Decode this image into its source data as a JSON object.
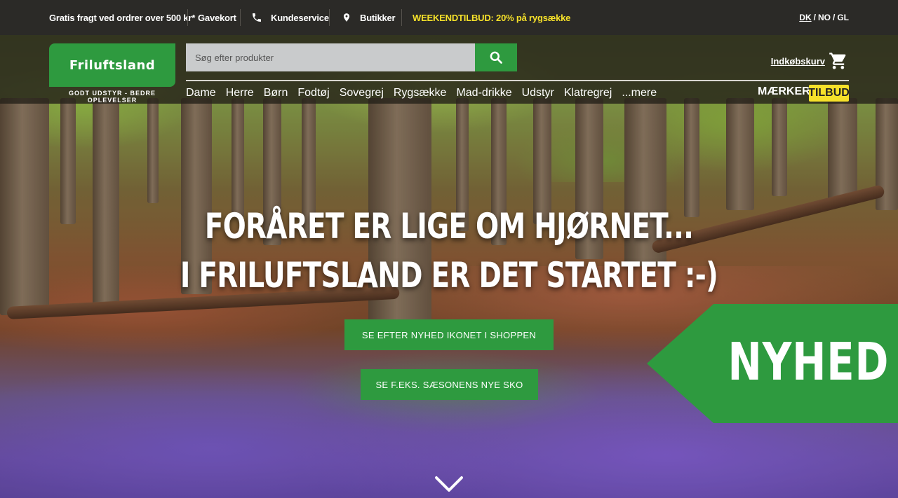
{
  "topbar": {
    "shipping": "Gratis fragt ved ordrer over 500 kr*",
    "giftcard": "Gavekort",
    "customer_service": "Kundeservice",
    "stores": "Butikker",
    "promo": "WEEKENDTILBUD: 20% på rygsække",
    "languages": [
      {
        "code": "DK",
        "active": true
      },
      {
        "code": "NO",
        "active": false
      },
      {
        "code": "GL",
        "active": false
      }
    ],
    "lang_dk": "DK",
    "lang_no": "NO",
    "lang_gl": "GL",
    "lang_sep": "/"
  },
  "header": {
    "logo_text": "Friluftsland",
    "tagline": "GODT UDSTYR - BEDRE OPLEVELSER",
    "search_placeholder": "Søg efter produkter",
    "cart_label": "Indkøbskurv",
    "nav": [
      "Dame",
      "Herre",
      "Børn",
      "Fodtøj",
      "Sovegrej",
      "Rygsække",
      "Mad-drikke",
      "Udstyr",
      "Klatregrej",
      "...mere"
    ],
    "brands": "MÆRKER",
    "deals": "TILBUD"
  },
  "hero": {
    "headline_1": "FORÅRET ER LIGE OM HJØRNET...",
    "headline_2": "I FRILUFTSLAND ER DET STARTET :-)",
    "cta_1": "SE EFTER NYHED IKONET I SHOPPEN",
    "cta_2": "SE F.EKS. SÆSONENS NYE SKO",
    "badge": "NYHED"
  },
  "colors": {
    "brand_green": "#2e9a3f",
    "promo_yellow": "#f6e12a",
    "topbar_bg": "#2b2a27"
  },
  "icons": [
    "phone-icon",
    "location-pin-icon",
    "search-icon",
    "cart-icon",
    "chevron-down-icon"
  ]
}
